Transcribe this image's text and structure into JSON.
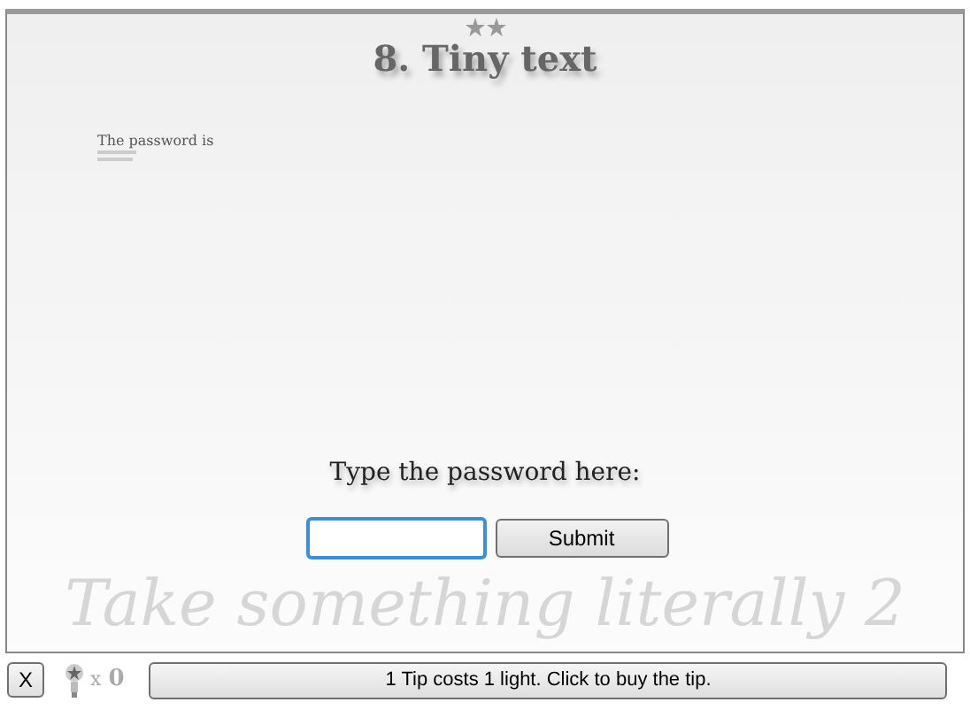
{
  "level": {
    "title": "8. Tiny text"
  },
  "hint_lines": [
    "The password is"
  ],
  "prompt": "Type the password here:",
  "submit_button": "Submit",
  "subtitle": "Take something literally 2",
  "footer": {
    "close_button": "X",
    "times": "x",
    "lights": "0",
    "tip_button": "1 Tip costs 1 light. Click to buy the tip."
  }
}
